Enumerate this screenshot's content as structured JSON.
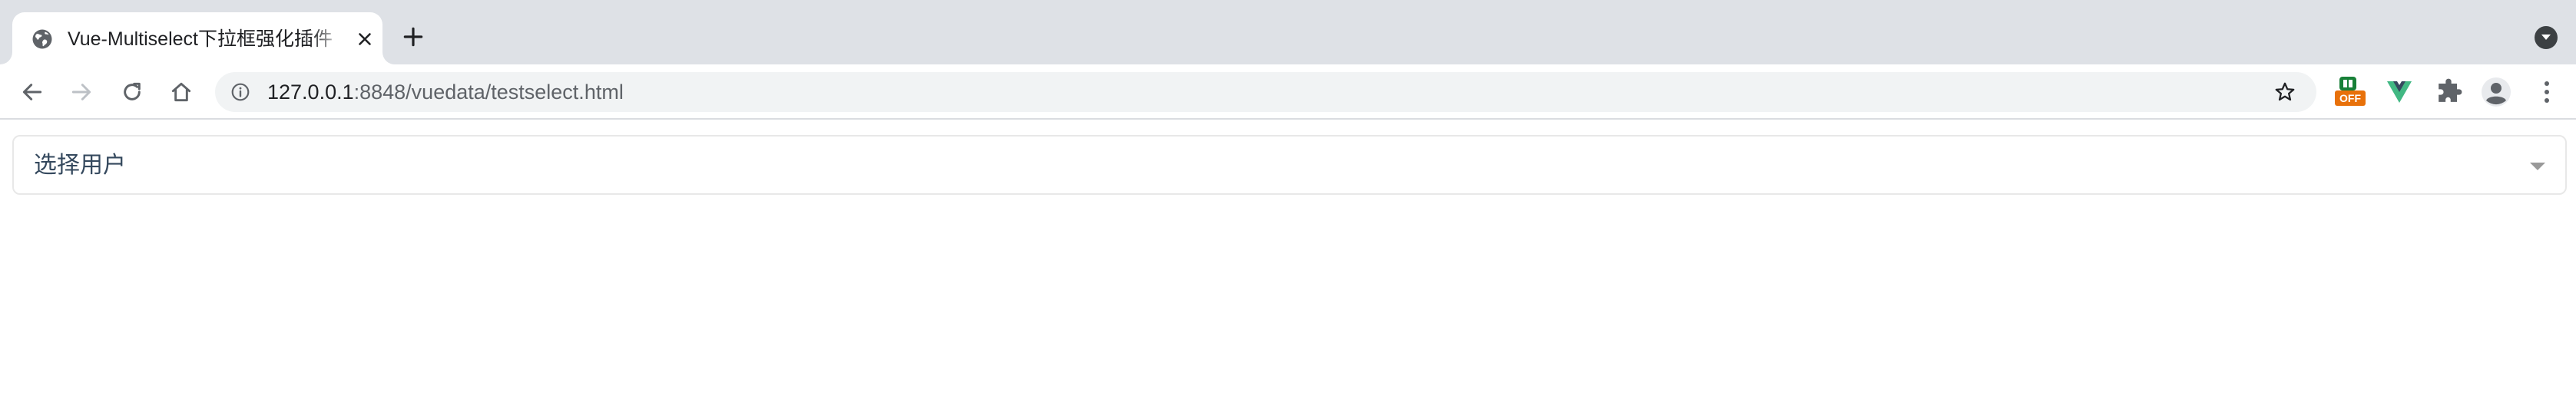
{
  "browser": {
    "tab": {
      "title": "Vue-Multiselect下拉框强化插件",
      "favicon": "globe-icon",
      "close_icon": "close-icon"
    },
    "new_tab_icon": "plus-icon",
    "tab_search_icon": "chevron-down-icon",
    "toolbar": {
      "back_icon": "arrow-left-icon",
      "forward_icon": "arrow-right-icon",
      "reload_icon": "reload-icon",
      "home_icon": "home-icon"
    },
    "address_bar": {
      "info_icon": "info-icon",
      "url_host": "127.0.0.1",
      "url_rest": ":8848/vuedata/testselect.html",
      "bookmark_icon": "star-icon"
    },
    "extensions": {
      "ext1_badge": "OFF",
      "ext1_icon": "ext-off-icon",
      "ext2_icon": "vue-devtools-icon",
      "ext3_icon": "puzzle-icon",
      "profile_icon": "profile-icon",
      "menu_icon": "kebab-menu-icon"
    }
  },
  "page": {
    "multiselect": {
      "placeholder": "选择用户",
      "caret_icon": "caret-down-icon"
    }
  },
  "colors": {
    "tabstrip_bg": "#dee1e6",
    "omnibox_bg": "#f1f3f4",
    "placeholder_text": "#35495e",
    "ext_orange": "#e8710a",
    "ext_green": "#188038",
    "vue_green": "#41b883"
  }
}
